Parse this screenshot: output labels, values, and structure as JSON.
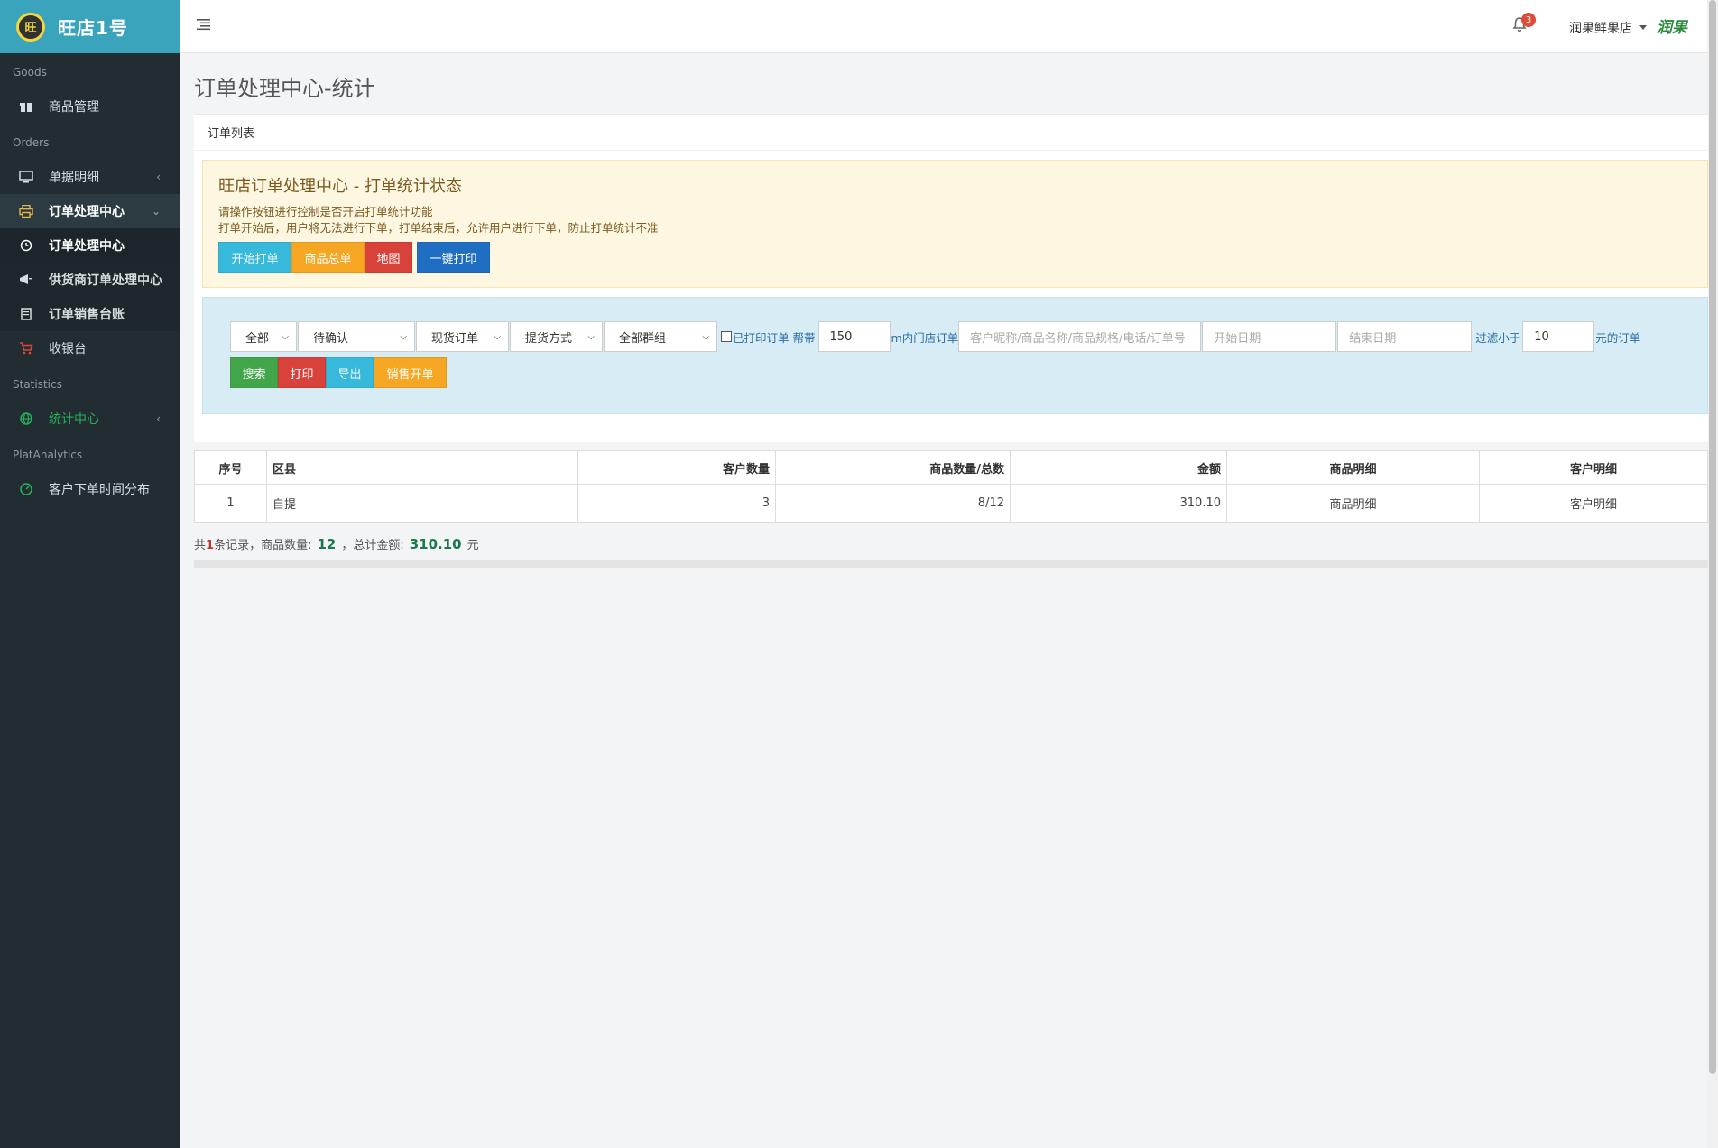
{
  "brand": {
    "logo_char": "旺",
    "name": "旺店1号"
  },
  "sidebar": {
    "sections": [
      {
        "header": "Goods",
        "items": [
          {
            "label": "商品管理",
            "icon": "gift-icon"
          }
        ]
      },
      {
        "header": "Orders",
        "items": [
          {
            "label": "单据明细",
            "icon": "monitor-icon",
            "chevron": "‹"
          },
          {
            "label": "订单处理中心",
            "icon": "printer-icon",
            "chevron": "⌄"
          },
          {
            "label": "订单处理中心",
            "icon": "clock-icon"
          },
          {
            "label": "供货商订单处理中心",
            "icon": "megaphone-icon"
          },
          {
            "label": "订单销售台账",
            "icon": "ledger-icon"
          },
          {
            "label": "收银台",
            "icon": "cart-icon"
          }
        ]
      },
      {
        "header": "Statistics",
        "items": [
          {
            "label": "统计中心",
            "icon": "globe-icon",
            "chevron": "‹"
          }
        ]
      },
      {
        "header": "PlatAnalytics",
        "items": [
          {
            "label": "客户下单时间分布",
            "icon": "speedometer-icon"
          }
        ]
      }
    ]
  },
  "topbar": {
    "notification_count": "3",
    "store_name": "润果鲜果店",
    "store_logo_text": "润果"
  },
  "page": {
    "title": "订单处理中心-统计"
  },
  "box": {
    "header": "订单列表"
  },
  "callout": {
    "title": "旺店订单处理中心 - 打单统计状态",
    "line1": "请操作按钮进行控制是否开启打单统计功能",
    "line2": "打单开始后，用户将无法进行下单，打单结束后，允许用户进行下单，防止打单统计不准",
    "buttons": {
      "start": "开始打单",
      "summary": "商品总单",
      "map": "地图",
      "print_all": "一键打印"
    }
  },
  "filter": {
    "select_all": "全部",
    "select_status": "待确认",
    "select_order_type": "现货订单",
    "select_pickup": "提货方式",
    "select_group": "全部群组",
    "printed_label": "已打印订单",
    "help_label": "帮带",
    "help_value": "150",
    "radius_label": "m内门店订单",
    "search_placeholder": "客户昵称/商品名称/商品规格/电话/订单号",
    "start_date_placeholder": "开始日期",
    "end_date_placeholder": "结束日期",
    "filter_label": "过滤小于",
    "filter_value": "10",
    "filter_suffix": "元的订单",
    "buttons": {
      "search": "搜索",
      "print": "打印",
      "export": "导出",
      "sales": "销售开单"
    }
  },
  "table": {
    "headers": [
      "序号",
      "区县",
      "客户数量",
      "商品数量/总数",
      "金额",
      "商品明细",
      "客户明细"
    ],
    "rows": [
      [
        "1",
        "自提",
        "3",
        "8/12",
        "310.10",
        "商品明细",
        "客户明细"
      ]
    ]
  },
  "summary": {
    "prefix": "共",
    "count": "1",
    "mid": "条记录，商品数量:",
    "qty": "12",
    "mid2": "，总计金额:",
    "amount": "310.10",
    "unit": "元"
  }
}
